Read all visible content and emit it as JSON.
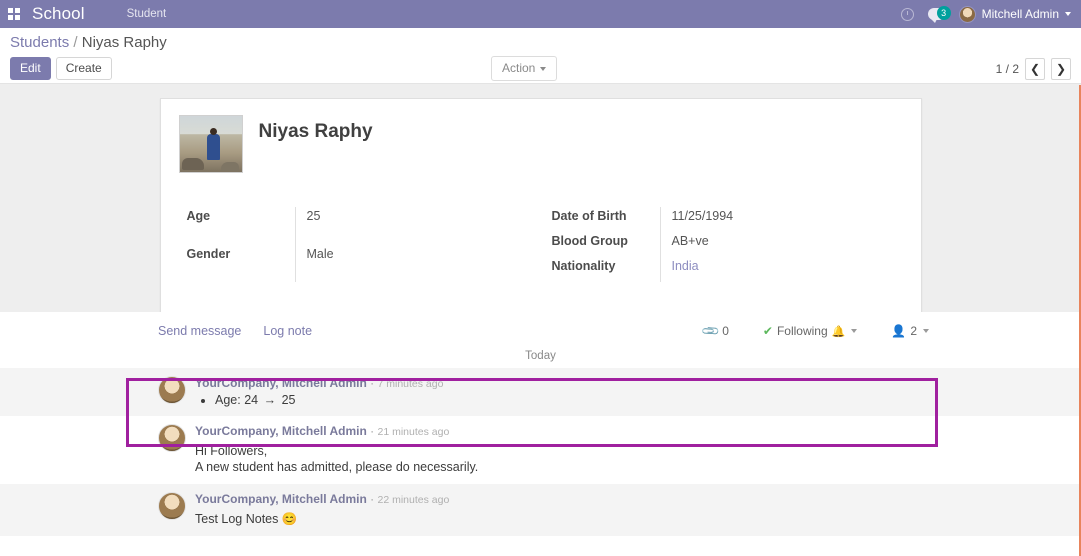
{
  "navbar": {
    "apps_icon": "apps-grid-icon",
    "brand": "School",
    "menus": [
      "Student"
    ],
    "clock_icon": "clock-icon",
    "chat_icon": "chat-bubble-icon",
    "chat_badge": "3",
    "user_name": "Mitchell Admin",
    "accent_color": "#7C7BAD",
    "badge_color": "#00A09D"
  },
  "control_panel": {
    "breadcrumb_root": "Students",
    "breadcrumb_sep": "/",
    "breadcrumb_current": "Niyas Raphy",
    "edit_label": "Edit",
    "create_label": "Create",
    "action_label": "Action",
    "pager_text": "1 / 2",
    "prev_icon": "chevron-left-icon",
    "next_icon": "chevron-right-icon"
  },
  "form": {
    "record_name": "Niyas Raphy",
    "photo_alt": "student-photo",
    "left_fields": [
      {
        "label": "Age",
        "value": "25",
        "link": false
      },
      {
        "label": "Gender",
        "value": "Male",
        "link": false
      }
    ],
    "right_fields": [
      {
        "label": "Date of Birth",
        "value": "11/25/1994",
        "link": false
      },
      {
        "label": "Blood Group",
        "value": "AB+ve",
        "link": false
      },
      {
        "label": "Nationality",
        "value": "India",
        "link": true
      }
    ]
  },
  "chatter": {
    "send_message": "Send message",
    "log_note": "Log note",
    "attachment_icon": "paperclip-icon",
    "attachment_count": "0",
    "following_check": "✔",
    "following_label": "Following",
    "bell_icon": "bell-icon",
    "followers_icon": "user-icon",
    "followers_count": "2",
    "day_separator": "Today",
    "messages": [
      {
        "author": "YourCompany, Mitchell Admin",
        "separator": "·",
        "time": "7 minutes ago",
        "tracking": [
          {
            "field": "Age:",
            "old": "24",
            "arrow": "→",
            "new": "25"
          }
        ],
        "lines": [],
        "highlighted": true
      },
      {
        "author": "YourCompany, Mitchell Admin",
        "separator": "·",
        "time": "21 minutes ago",
        "tracking": [],
        "lines": [
          "Hi Followers,",
          "A new student has admitted, please do necessarily."
        ],
        "highlighted": false
      },
      {
        "author": "YourCompany, Mitchell Admin",
        "separator": "·",
        "time": "22 minutes ago",
        "tracking": [],
        "lines": [
          "Test Log Notes 😊"
        ],
        "highlighted": false
      }
    ]
  },
  "annotation": {
    "color": "#A0209F",
    "label": "highlight-box"
  }
}
